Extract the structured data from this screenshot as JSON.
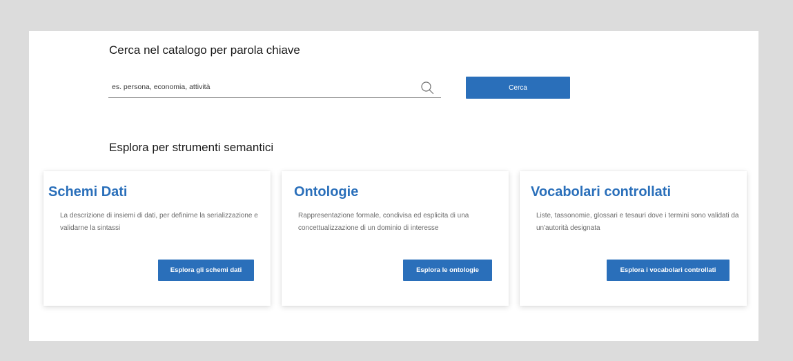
{
  "search": {
    "title": "Cerca nel catalogo per parola chiave",
    "placeholder": "es. persona, economia, attività",
    "button_label": "Cerca",
    "icon": "search-icon"
  },
  "explore": {
    "title": "Esplora per strumenti semantici"
  },
  "cards": [
    {
      "title": "Schemi Dati",
      "description": "La descrizione di insiemi di dati, per definirne la serializzazione e validarne la sintassi",
      "button_label": "Esplora gli schemi dati"
    },
    {
      "title": "Ontologie",
      "description": "Rappresentazione formale, condivisa ed esplicita di una concettualizzazione di un dominio di interesse",
      "button_label": "Esplora le ontologie"
    },
    {
      "title": "Vocabolari controllati",
      "description": "Liste, tassonomie, glossari e tesauri dove i termini sono validati da un'autorità designata",
      "button_label": "Esplora i vocabolari controllati"
    }
  ],
  "colors": {
    "accent": "#2a6fba",
    "background": "#dcdcdc",
    "panel": "#ffffff"
  }
}
